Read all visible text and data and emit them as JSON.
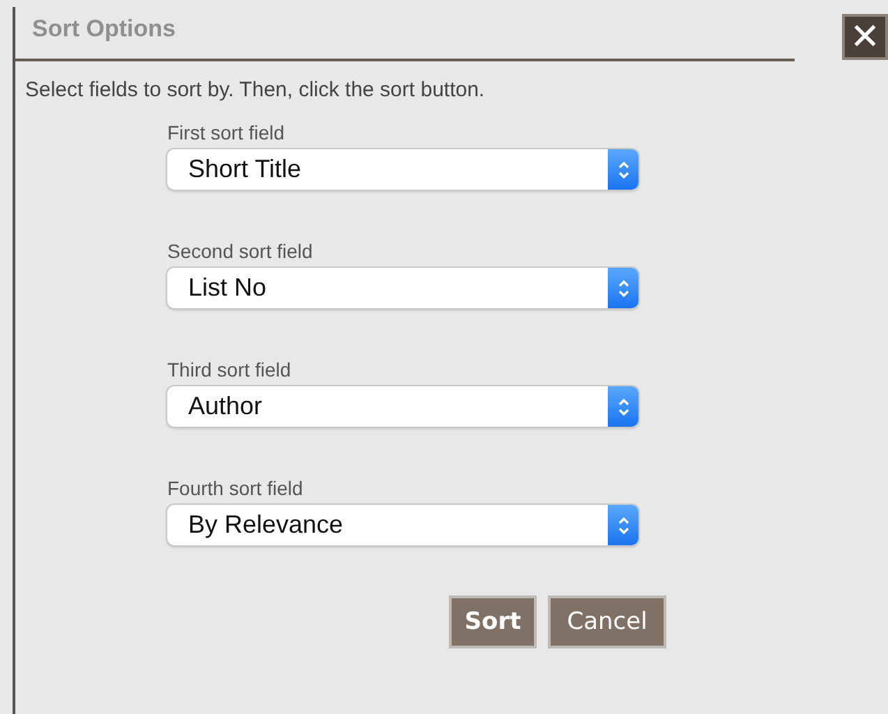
{
  "dialog": {
    "title": "Sort Options",
    "close_label": "✕",
    "instruction": "Select fields to sort by. Then, click the sort button.",
    "fields": [
      {
        "label": "First sort field",
        "value": "Short Title"
      },
      {
        "label": "Second sort field",
        "value": "List No"
      },
      {
        "label": "Third sort field",
        "value": "Author"
      },
      {
        "label": "Fourth sort field",
        "value": "By Relevance"
      }
    ],
    "buttons": [
      {
        "label": "Sort",
        "kind": "primary"
      },
      {
        "label": "Cancel",
        "kind": "secondary"
      }
    ]
  }
}
